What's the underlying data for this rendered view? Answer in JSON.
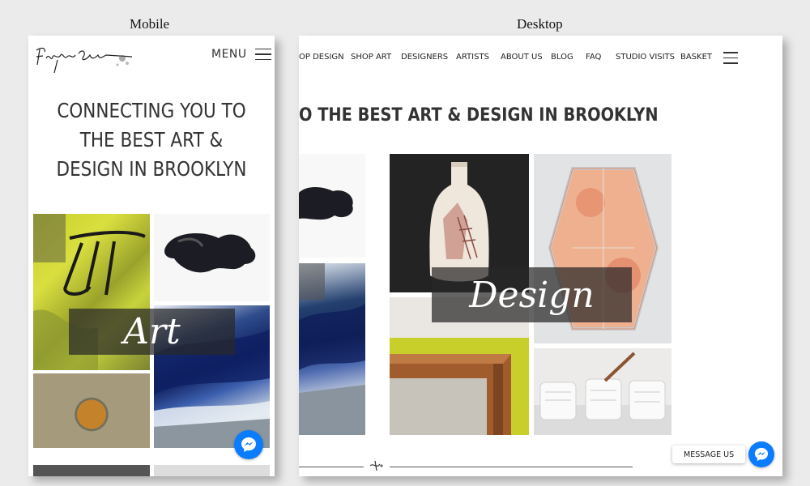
{
  "captions": {
    "mobile": "Mobile",
    "desktop": "Desktop"
  },
  "mobile": {
    "logo_alt": "Fiercely Curious",
    "menu_label": "MENU",
    "headline": "CONNECTING YOU TO THE BEST ART & DESIGN IN BROOKLYN",
    "category_label": "Art",
    "messenger_icon": "messenger-icon"
  },
  "desktop": {
    "nav": [
      "OP DESIGN",
      "SHOP ART",
      "DESIGNERS",
      "ARTISTS",
      "ABOUT US",
      "BLOG",
      "FAQ",
      "STUDIO VISITS",
      "BASKET"
    ],
    "menu_icon": "hamburger-icon",
    "headline": "O THE BEST ART & DESIGN IN BROOKLYN",
    "category_label": "Design",
    "message_button": "MESSAGE US",
    "messenger_icon": "messenger-icon"
  },
  "colors": {
    "messenger": "#0a7cff",
    "overlay": "rgba(40,40,40,0.72)",
    "text": "#333333"
  }
}
